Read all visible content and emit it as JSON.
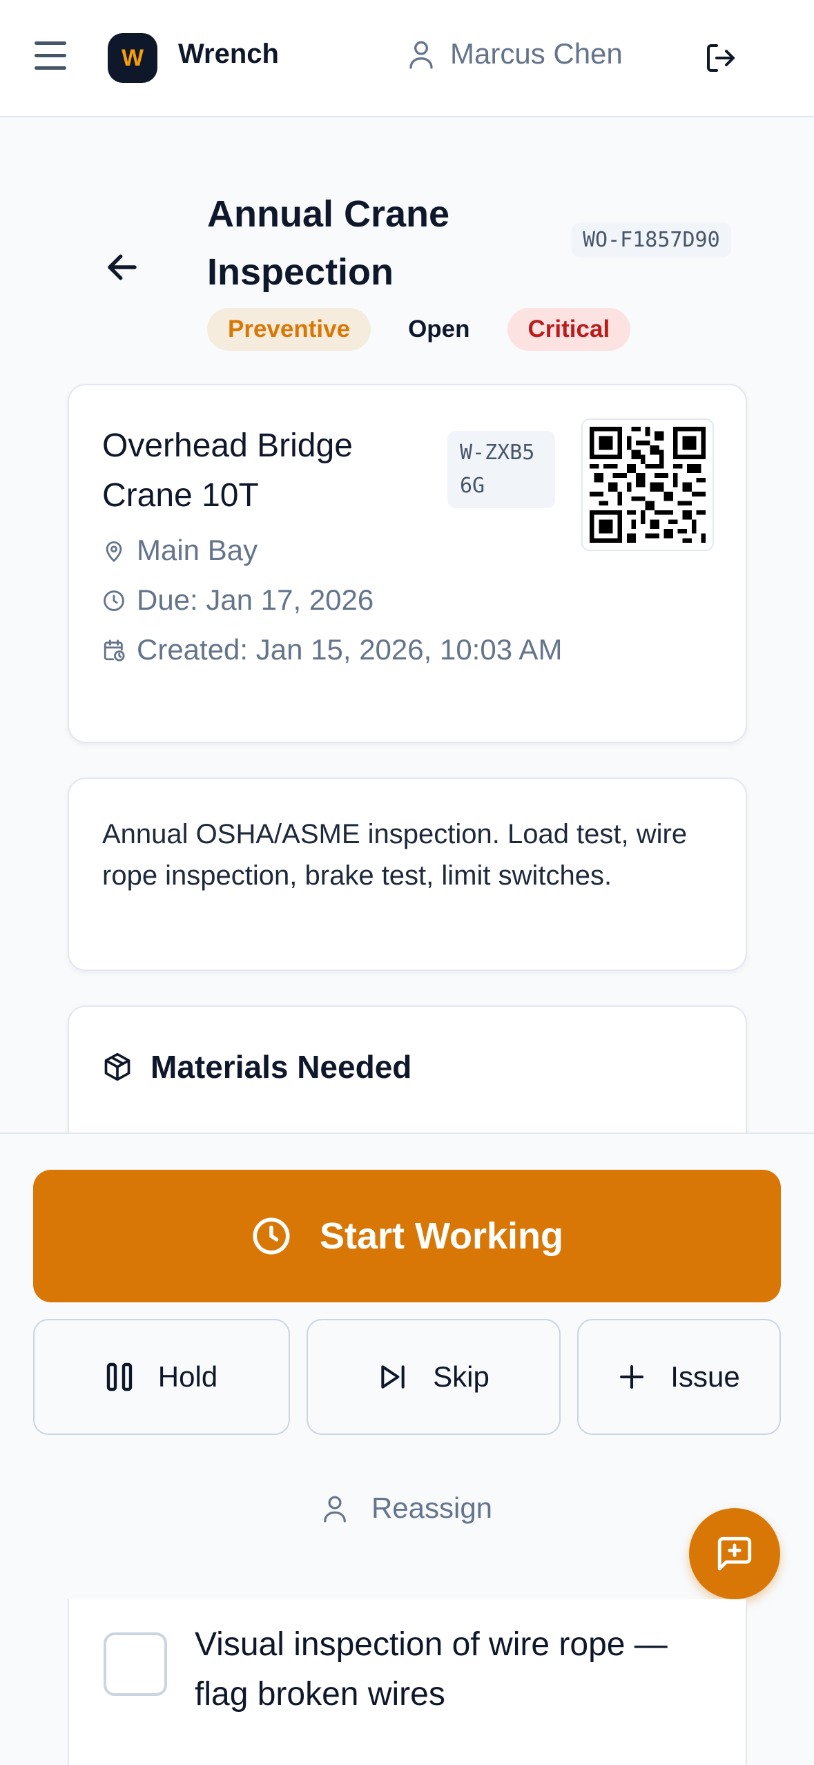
{
  "app": {
    "name": "Wrench",
    "logo_letter": "W",
    "accent": "#d97706"
  },
  "header": {
    "user_name": "Marcus Chen"
  },
  "work_order": {
    "title": "Annual Crane Inspection",
    "id": "WO-F1857D90",
    "badges": {
      "type": "Preventive",
      "status": "Open",
      "priority": "Critical"
    }
  },
  "asset": {
    "name": "Overhead Bridge Crane 10T",
    "id": "W-ZXB56G",
    "location": "Main Bay",
    "due": "Due: Jan 17, 2026",
    "created": "Created: Jan 15, 2026, 10:03 AM"
  },
  "description": "Annual OSHA/ASME inspection. Load test, wire rope inspection, brake test, limit switches.",
  "materials": {
    "heading": "Materials Needed"
  },
  "actions": {
    "start": "Start Working",
    "hold": "Hold",
    "skip": "Skip",
    "issue": "Issue",
    "reassign": "Reassign"
  },
  "checklist": {
    "items": [
      {
        "label": "Visual inspection of wire rope — flag broken wires",
        "checked": false
      }
    ]
  },
  "icons": {
    "menu": "menu-icon",
    "user": "user-icon",
    "logout": "logout-icon",
    "back": "arrow-left-icon",
    "location": "map-pin-icon",
    "due": "clock-icon",
    "created": "calendar-clock-icon",
    "materials": "package-icon",
    "start": "clock-icon",
    "hold": "pause-icon",
    "skip": "skip-forward-icon",
    "issue": "plus-icon",
    "reassign": "user-icon",
    "fab": "message-plus-icon"
  }
}
